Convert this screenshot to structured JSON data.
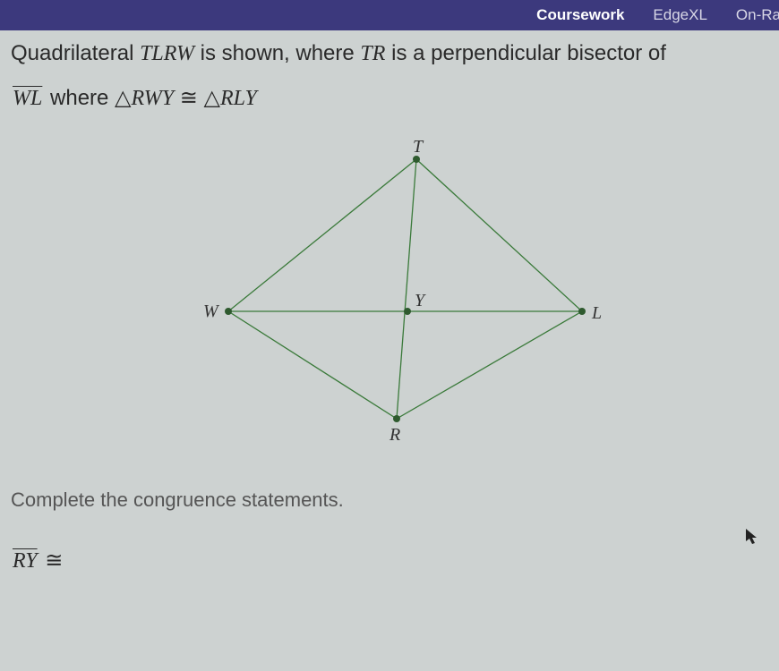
{
  "header": {
    "nav": [
      "Coursework",
      "EdgeXL",
      "On-Ra"
    ]
  },
  "problem": {
    "line1_pre": "Quadrilateral ",
    "quad_name": "TLRW",
    "line1_mid": " is shown, where ",
    "seg_TR": "TR",
    "line1_post": " is a perpendicular bisector of",
    "seg_WL": "WL",
    "line2_mid": " where ",
    "tri1": "RWY",
    "tri2": "RLY"
  },
  "figure": {
    "labels": {
      "T": "T",
      "W": "W",
      "Y": "Y",
      "L": "L",
      "R": "R"
    }
  },
  "prompt": "Complete the congruence statements.",
  "answer": {
    "seg": "RY",
    "rel": "≅"
  },
  "symbols": {
    "triangle": "△",
    "congruent": "≅"
  }
}
